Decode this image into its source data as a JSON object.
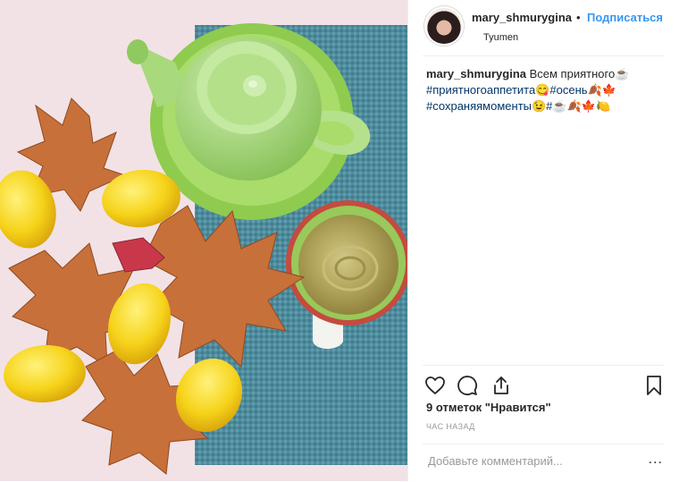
{
  "post": {
    "author": {
      "username": "mary_shmurygina",
      "follow_label": "Подписаться",
      "separator": "•",
      "location": "Tyumen"
    },
    "caption": {
      "username": "mary_shmurygina",
      "text": " Всем приятного☕",
      "tags_line1": "#приятногоаппетита😋#осень🍂🍁",
      "tags_line2": "#сохраняямоменты😉#☕🍂🍁🍋"
    },
    "likes_label": "9 отметок \"Нравится\"",
    "timestamp": "ЧАС НАЗАД",
    "comment": {
      "placeholder": "Добавьте комментарий...",
      "more_label": "..."
    },
    "icons": [
      "heart-icon",
      "comment-icon",
      "share-icon",
      "bookmark-icon"
    ]
  },
  "colors": {
    "link_blue": "#3897f0",
    "tag_blue": "#003569",
    "teapot_green": "#9bd46a",
    "lemon_yellow": "#f5d41c",
    "leaf_orange": "#c86a2e",
    "mat_blue": "#4f8fa1"
  }
}
